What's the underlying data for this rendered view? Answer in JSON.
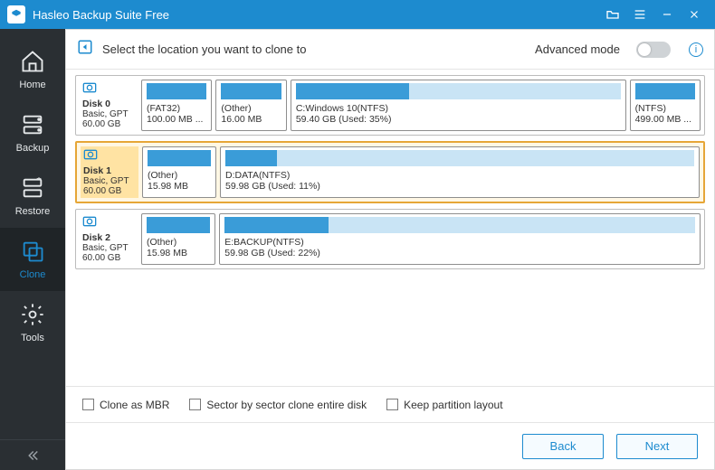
{
  "app": {
    "title": "Hasleo Backup Suite Free"
  },
  "sidebar": {
    "items": [
      {
        "label": "Home"
      },
      {
        "label": "Backup"
      },
      {
        "label": "Restore"
      },
      {
        "label": "Clone"
      },
      {
        "label": "Tools"
      }
    ]
  },
  "instruction": {
    "text": "Select the location you want to clone to",
    "advanced_label": "Advanced mode",
    "advanced_on": false
  },
  "disks": [
    {
      "name": "Disk 0",
      "info": "Basic, GPT",
      "size": "60.00 GB",
      "selected": false,
      "partitions": [
        {
          "label": "(FAT32)",
          "size": "100.00 MB ...",
          "used_pct": 100,
          "flex": 1
        },
        {
          "label": "(Other)",
          "size": "16.00 MB",
          "used_pct": 100,
          "flex": 1
        },
        {
          "label": "C:Windows 10(NTFS)",
          "size": "59.40 GB (Used: 35%)",
          "used_pct": 35,
          "flex": 5.4
        },
        {
          "label": "(NTFS)",
          "size": "499.00 MB ...",
          "used_pct": 100,
          "flex": 1
        }
      ]
    },
    {
      "name": "Disk 1",
      "info": "Basic, GPT",
      "size": "60.00 GB",
      "selected": true,
      "partitions": [
        {
          "label": "(Other)",
          "size": "15.98 MB",
          "used_pct": 100,
          "flex": 1
        },
        {
          "label": "D:DATA(NTFS)",
          "size": "59.98 GB (Used: 11%)",
          "used_pct": 11,
          "flex": 7.4
        }
      ]
    },
    {
      "name": "Disk 2",
      "info": "Basic, GPT",
      "size": "60.00 GB",
      "selected": false,
      "partitions": [
        {
          "label": "(Other)",
          "size": "15.98 MB",
          "used_pct": 100,
          "flex": 1
        },
        {
          "label": "E:BACKUP(NTFS)",
          "size": "59.98 GB (Used: 22%)",
          "used_pct": 22,
          "flex": 7.4
        }
      ]
    }
  ],
  "options": {
    "clone_mbr": "Clone as MBR",
    "sector_by_sector": "Sector by sector clone entire disk",
    "keep_layout": "Keep partition layout"
  },
  "footer": {
    "back": "Back",
    "next": "Next"
  }
}
